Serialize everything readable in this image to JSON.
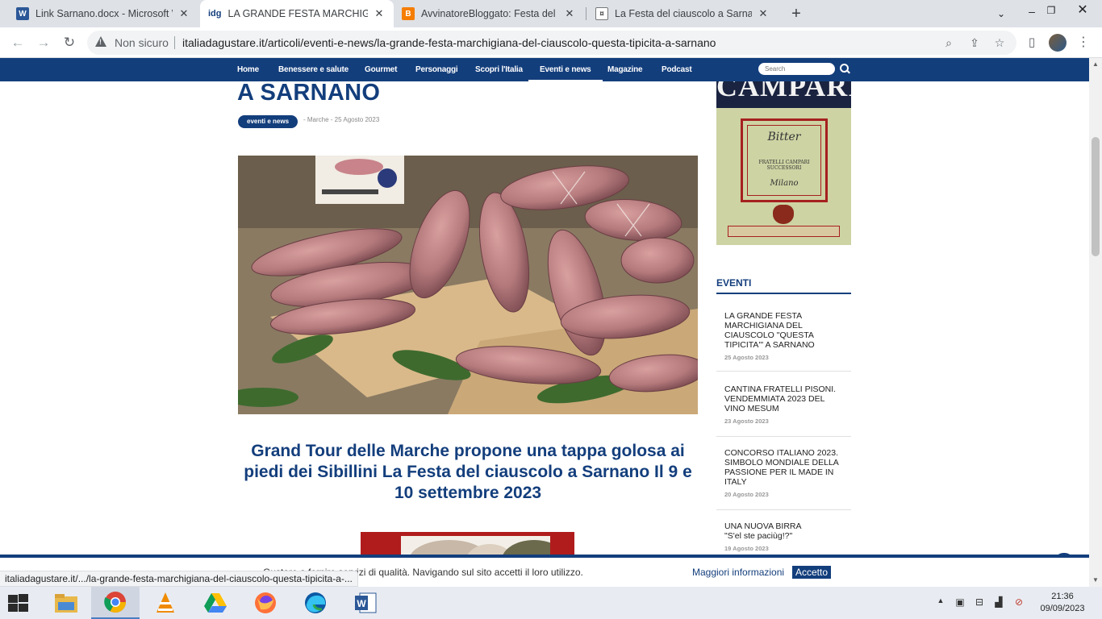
{
  "browser": {
    "tabs": [
      {
        "label": "Link Sarnano.docx - Microsoft Word",
        "favicon": "word-icon",
        "active": false
      },
      {
        "label": "LA GRANDE FESTA MARCHIGIANA",
        "favicon": "idg-icon",
        "favicon_text": "idg",
        "active": true
      },
      {
        "label": "AvvinatoreBloggato: Festa del ciauscolo",
        "favicon": "blogger-icon",
        "active": false
      },
      {
        "label": "La Festa del ciauscolo a Sarnano",
        "favicon": "site-icon",
        "active": false
      }
    ],
    "new_tab_icon": "plus-icon",
    "security_label": "Non sicuro",
    "url": "italiadagustare.it/articoli/eventi-e-news/la-grande-festa-marchigiana-del-ciauscolo-questa-tipicita-a-sarnano",
    "status_url": "italiadagustare.it/.../la-grande-festa-marchigiana-del-ciauscolo-questa-tipicita-a-..."
  },
  "site": {
    "nav": [
      "Home",
      "Benessere e salute",
      "Gourmet",
      "Personaggi",
      "Scopri l'Italia",
      "Eventi e news",
      "Magazine",
      "Podcast"
    ],
    "active_nav": "Eventi e news",
    "search_placeholder": "Search",
    "brand_color": "#133e7c"
  },
  "article": {
    "title_tail": "A SARNANO",
    "category": "eventi e news",
    "meta": "- Marche - 25 Agosto 2023",
    "subheading": "Grand Tour delle Marche  propone una tappa golosa ai piedi dei Sibillini  La Festa del ciauscolo a Sarnano Il 9 e 10 settembre 2023"
  },
  "sidebar": {
    "ad": {
      "brand": "CAMPARI",
      "script_top": "Bitter",
      "fine_print": "FRATELLI CAMPARI SUCCESSORI",
      "script_bottom": "Milano"
    },
    "events_heading": "EVENTI",
    "events": [
      {
        "title": "LA GRANDE FESTA MARCHIGIANA DEL CIAUSCOLO \"QUESTA TIPICITA'\" A SARNANO",
        "date": "25 Agosto 2023"
      },
      {
        "title": "CANTINA FRATELLI PISONI. VENDEMMIATA 2023 DEL VINO MESUM",
        "date": "23 Agosto 2023"
      },
      {
        "title": "CONCORSO ITALIANO 2023. SIMBOLO MONDIALE DELLA PASSIONE PER IL MADE IN ITALY",
        "date": "20 Agosto 2023"
      },
      {
        "title": "UNA NUOVA BIRRA \"S'el ste paciùg!?\"",
        "date": "19 Agosto 2023"
      }
    ]
  },
  "cookie": {
    "text": "...Gustare a fornire servizi di qualità. Navigando sul sito accetti il loro utilizzo.",
    "link": "Maggiori informazioni",
    "button": "Accetto"
  },
  "taskbar": {
    "apps": [
      "file-explorer-icon",
      "chrome-icon",
      "vlc-icon",
      "google-drive-icon",
      "firefox-icon",
      "edge-icon",
      "word-icon"
    ],
    "time": "21:36",
    "date": "09/09/2023"
  }
}
